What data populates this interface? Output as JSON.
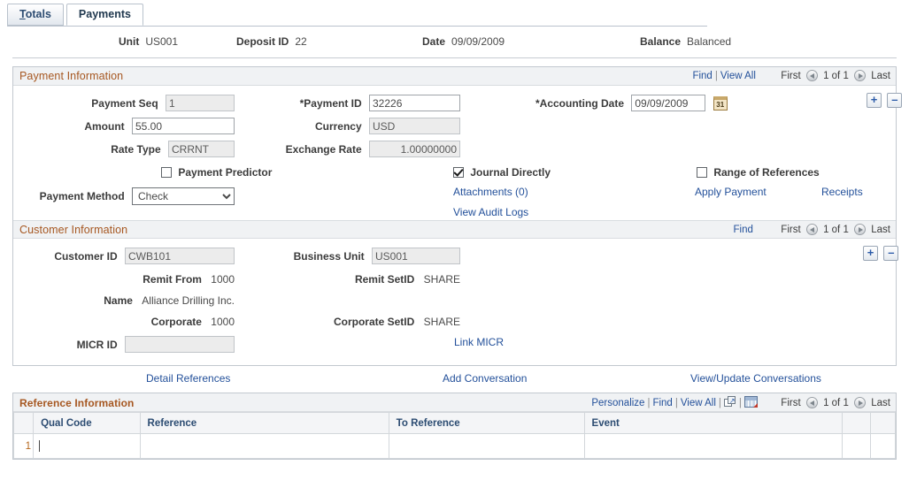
{
  "tabs": [
    {
      "label": "Totals",
      "accesskey": "T",
      "active": false
    },
    {
      "label": "Payments",
      "accesskey": "",
      "active": true
    }
  ],
  "keybar": [
    {
      "label": "Unit",
      "value": "US001"
    },
    {
      "label": "Deposit ID",
      "value": "22"
    },
    {
      "label": "Date",
      "value": "09/09/2009"
    },
    {
      "label": "Balance",
      "value": "Balanced"
    }
  ],
  "payment_information": {
    "title": "Payment Information",
    "nav": {
      "find": "Find",
      "view_all": "View All",
      "first": "First",
      "counter": "1 of 1",
      "last": "Last"
    },
    "payment_seq_label": "Payment Seq",
    "payment_seq_value": "1",
    "amount_label": "Amount",
    "amount_value": "55.00",
    "rate_type_label": "Rate Type",
    "rate_type_value": "CRRNT",
    "payment_predictor_label": "Payment Predictor",
    "payment_predictor_checked": false,
    "payment_method_label": "Payment Method",
    "payment_method_value": "Check",
    "payment_method_options": [
      "Check"
    ],
    "payment_id_label": "*Payment ID",
    "payment_id_value": "32226",
    "currency_label": "Currency",
    "currency_value": "USD",
    "exchange_rate_label": "Exchange Rate",
    "exchange_rate_value": "1.00000000",
    "journal_directly_label": "Journal Directly",
    "journal_directly_checked": true,
    "attachments_label": "Attachments (0)",
    "view_audit_logs_label": "View Audit Logs",
    "accounting_date_label": "*Accounting Date",
    "accounting_date_value": "09/09/2009",
    "calendar_icon_text": "31",
    "range_of_references_label": "Range of References",
    "range_of_references_checked": false,
    "apply_payment_label": "Apply Payment",
    "receipts_label": "Receipts",
    "add_row_label": "+",
    "delete_row_label": "–"
  },
  "customer_information": {
    "title": "Customer Information",
    "nav": {
      "find": "Find",
      "first": "First",
      "counter": "1 of 1",
      "last": "Last"
    },
    "customer_id_label": "Customer ID",
    "customer_id_value": "CWB101",
    "remit_from_label": "Remit From",
    "remit_from_value": "1000",
    "name_label": "Name",
    "name_value": "Alliance Drilling Inc.",
    "corporate_label": "Corporate",
    "corporate_value": "1000",
    "micr_id_label": "MICR ID",
    "micr_id_value": "",
    "business_unit_label": "Business Unit",
    "business_unit_value": "US001",
    "remit_setid_label": "Remit SetID",
    "remit_setid_value": "SHARE",
    "corporate_setid_label": "Corporate SetID",
    "corporate_setid_value": "SHARE",
    "link_micr_label": "Link MICR",
    "add_row_label": "+",
    "delete_row_label": "–"
  },
  "link_row": {
    "detail_references": "Detail References",
    "add_conversation": "Add Conversation",
    "view_update_conversations": "View/Update Conversations"
  },
  "reference_information": {
    "title": "Reference Information",
    "toolbar": {
      "personalize": "Personalize",
      "find": "Find",
      "view_all": "View All",
      "expand_icon": "expand-icon",
      "download_icon": "download-grid-icon",
      "first": "First",
      "counter": "1 of 1",
      "last": "Last"
    },
    "columns": [
      "",
      "Qual Code",
      "Reference",
      "To Reference",
      "Event",
      "",
      ""
    ],
    "rows": [
      {
        "num": "1",
        "qual_code": "",
        "reference": "",
        "to_reference": "",
        "event": ""
      }
    ]
  },
  "colors": {
    "section_title": "#a65721",
    "link": "#23509a",
    "column_header": "#2c4c72",
    "row_number": "#b4651a",
    "panel_border": "#c2c8cf"
  }
}
